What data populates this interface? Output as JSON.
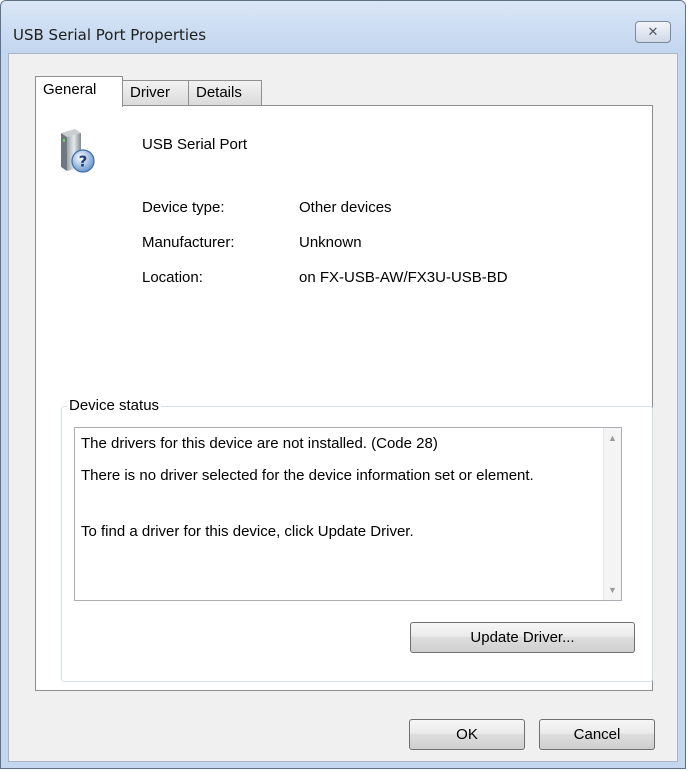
{
  "window": {
    "title": "USB Serial Port Properties"
  },
  "tabs": [
    {
      "label": "General",
      "active": true
    },
    {
      "label": "Driver",
      "active": false
    },
    {
      "label": "Details",
      "active": false
    }
  ],
  "general": {
    "device_name": "USB Serial Port",
    "device_icon": "unknown-device-icon",
    "properties": [
      {
        "label": "Device type:",
        "value": "Other devices"
      },
      {
        "label": "Manufacturer:",
        "value": "Unknown"
      },
      {
        "label": "Location:",
        "value": "on FX-USB-AW/FX3U-USB-BD"
      }
    ],
    "status_group_label": "Device status",
    "status_lines": [
      "The drivers for this device are not installed. (Code 28)",
      "There is no driver selected for the device information set or element.",
      "To find a driver for this device, click Update Driver."
    ],
    "update_driver_label": "Update Driver..."
  },
  "buttons": {
    "ok_label": "OK",
    "cancel_label": "Cancel"
  },
  "colors": {
    "titlebar": "#c4d7ee",
    "panel": "#ffffff",
    "dialog_bg": "#f0f0f0"
  }
}
